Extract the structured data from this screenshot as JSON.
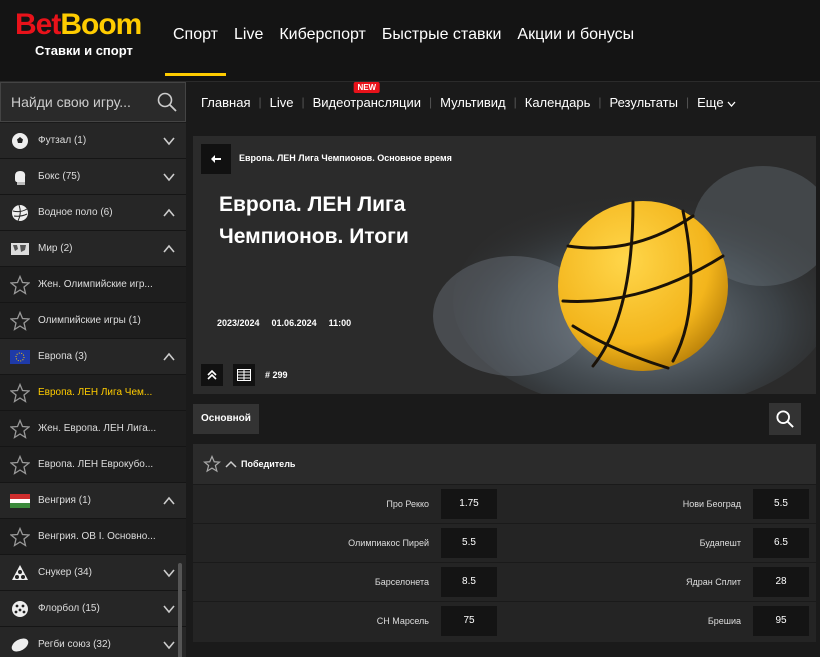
{
  "brand": {
    "name_a": "Bet",
    "name_b": "Boom",
    "tagline": "Ставки и спорт"
  },
  "nav": [
    {
      "label": "Спорт",
      "active": true
    },
    {
      "label": "Live"
    },
    {
      "label": "Киберспорт"
    },
    {
      "label": "Быстрые ставки"
    },
    {
      "label": "Акции и бонусы"
    }
  ],
  "search": {
    "placeholder": "Найди свою игру..."
  },
  "subnav": [
    {
      "label": "Главная"
    },
    {
      "label": "Live"
    },
    {
      "label": "Видеотрансляции",
      "badge": "NEW"
    },
    {
      "label": "Мультивид"
    },
    {
      "label": "Календарь"
    },
    {
      "label": "Результаты"
    },
    {
      "label": "Еще"
    }
  ],
  "sidebar": [
    {
      "label": "Футзал (1)",
      "icon": "futsal-ball-icon",
      "chev": "down"
    },
    {
      "label": "Бокс (75)",
      "icon": "boxing-glove-icon",
      "chev": "down"
    },
    {
      "label": "Водное поло (6)",
      "icon": "water-polo-ball-icon",
      "chev": "up"
    },
    {
      "label": "Мир (2)",
      "icon": "world-map-icon",
      "chev": "up"
    },
    {
      "label": "Жен. Олимпийские игр...",
      "icon": "star-icon",
      "sub": true
    },
    {
      "label": "Олимпийские игры (1)",
      "icon": "star-icon",
      "sub": true
    },
    {
      "label": "Европа (3)",
      "icon": "eu-flag-icon",
      "chev": "up"
    },
    {
      "label": "Европа. ЛЕН Лига Чем...",
      "icon": "star-icon",
      "sub": true,
      "selected": true
    },
    {
      "label": "Жен. Европа. ЛЕН Лига...",
      "icon": "star-icon",
      "sub": true
    },
    {
      "label": "Европа. ЛЕН Еврокубо...",
      "icon": "star-icon",
      "sub": true
    },
    {
      "label": "Венгрия (1)",
      "icon": "hungary-flag-icon",
      "chev": "up"
    },
    {
      "label": "Венгрия. OB I. Основно...",
      "icon": "star-icon",
      "sub": true
    },
    {
      "label": "Снукер (34)",
      "icon": "snooker-balls-icon",
      "chev": "down"
    },
    {
      "label": "Флорбол (15)",
      "icon": "floorball-icon",
      "chev": "down"
    },
    {
      "label": "Регби союз (32)",
      "icon": "rugby-ball-icon",
      "chev": "down"
    }
  ],
  "banner": {
    "breadcrumb": "Европа. ЛЕН Лига Чемпионов. Основное время",
    "title_line1": "Европа. ЛЕН Лига",
    "title_line2": "Чемпионов. Итоги",
    "season": "2023/2024",
    "date": "01.06.2024",
    "time": "11:00",
    "event_number": "# 299"
  },
  "tabs": {
    "main": "Основной"
  },
  "colors": {
    "accent": "#ffcc00",
    "brand_red": "#e8121a",
    "ball_yellow": "#f3b51c"
  },
  "market": {
    "title": "Победитель",
    "rows": [
      {
        "left_name": "Про Рекко",
        "left_odd": "1.75",
        "right_name": "Нови Београд",
        "right_odd": "5.5"
      },
      {
        "left_name": "Олимпиакос Пирей",
        "left_odd": "5.5",
        "right_name": "Будапешт",
        "right_odd": "6.5"
      },
      {
        "left_name": "Барселонета",
        "left_odd": "8.5",
        "right_name": "Ядран Сплит",
        "right_odd": "28"
      },
      {
        "left_name": "СН Марсель",
        "left_odd": "75",
        "right_name": "Брешиа",
        "right_odd": "95"
      }
    ]
  }
}
